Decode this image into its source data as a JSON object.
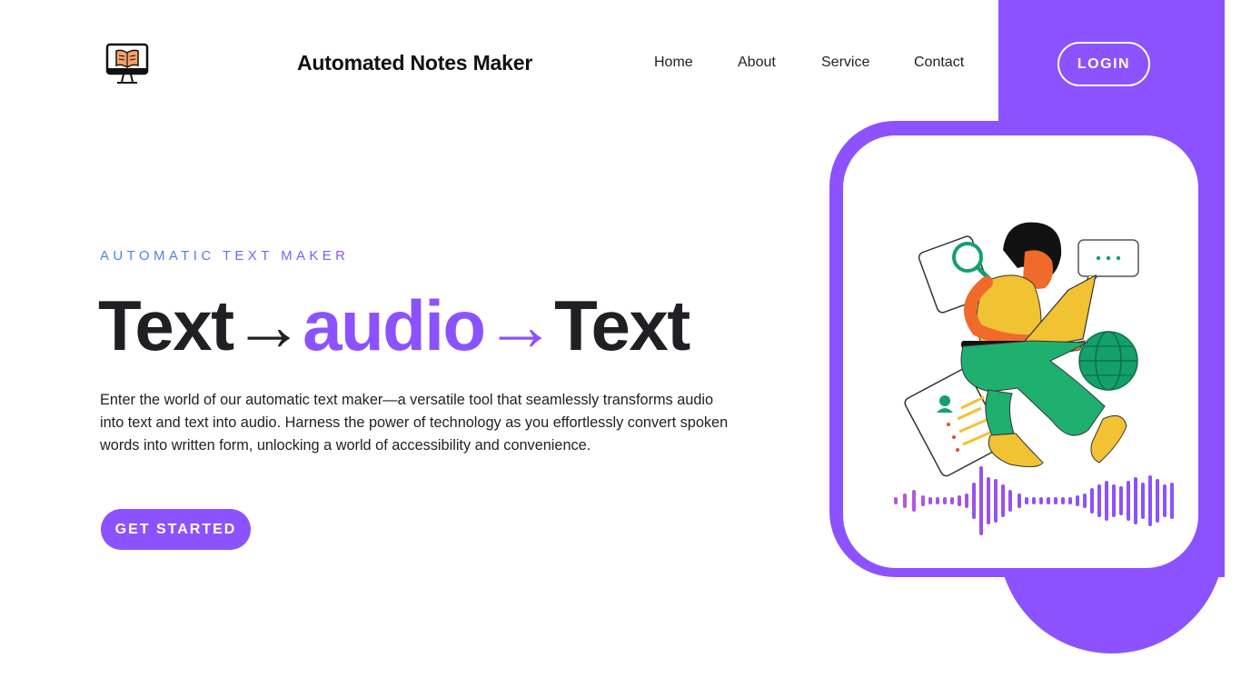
{
  "brand": {
    "name": "Automated Notes Maker",
    "logo_icon": "monitor-book-icon"
  },
  "nav": {
    "items": [
      "Home",
      "About",
      "Service",
      "Contact"
    ]
  },
  "header": {
    "login_label": "LOGIN"
  },
  "hero": {
    "eyebrow": "AUTOMATIC TEXT MAKER",
    "headline": {
      "part1": "Text",
      "arrow1": "→",
      "part2": "audio",
      "arrow2": "→",
      "part3": "Text"
    },
    "description": "Enter the world of our automatic text maker—a versatile tool that seamlessly transforms audio into text and text into audio. Harness the power of technology as you effortlessly convert spoken words into written form, unlocking a world of accessibility and convenience.",
    "cta_label": "GET STARTED"
  },
  "illustration": {
    "subject": "person-with-laptop-illustration",
    "elements": [
      "magnifier-icon",
      "chat-bubble-icon",
      "globe-icon",
      "document-icon",
      "audio-waveform"
    ]
  },
  "colors": {
    "accent": "#8c52ff",
    "text": "#1f1f24",
    "eyebrow_start": "#3d8bd8",
    "background": "#ffffff"
  }
}
